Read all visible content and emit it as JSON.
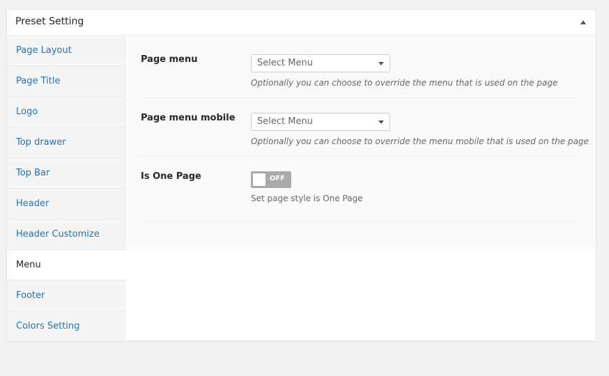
{
  "postbox": {
    "title": "Preset Setting"
  },
  "tabs": [
    {
      "label": "Page Layout"
    },
    {
      "label": "Page Title"
    },
    {
      "label": "Logo"
    },
    {
      "label": "Top drawer"
    },
    {
      "label": "Top Bar"
    },
    {
      "label": "Header"
    },
    {
      "label": "Header Customize"
    },
    {
      "label": "Menu",
      "active": true
    },
    {
      "label": "Footer"
    },
    {
      "label": "Colors Setting"
    }
  ],
  "fields": {
    "page_menu": {
      "label": "Page menu",
      "value": "Select Menu",
      "description": "Optionally you can choose to override the menu that is used on the page"
    },
    "page_menu_mobile": {
      "label": "Page menu mobile",
      "value": "Select Menu",
      "description": "Optionally you can choose to override the menu mobile that is used on the page"
    },
    "is_one_page": {
      "label": "Is One Page",
      "state": "OFF",
      "description": "Set page style is One Page"
    }
  },
  "colors": {
    "link": "#2271b1",
    "switch_off": "#aaaaaa"
  }
}
